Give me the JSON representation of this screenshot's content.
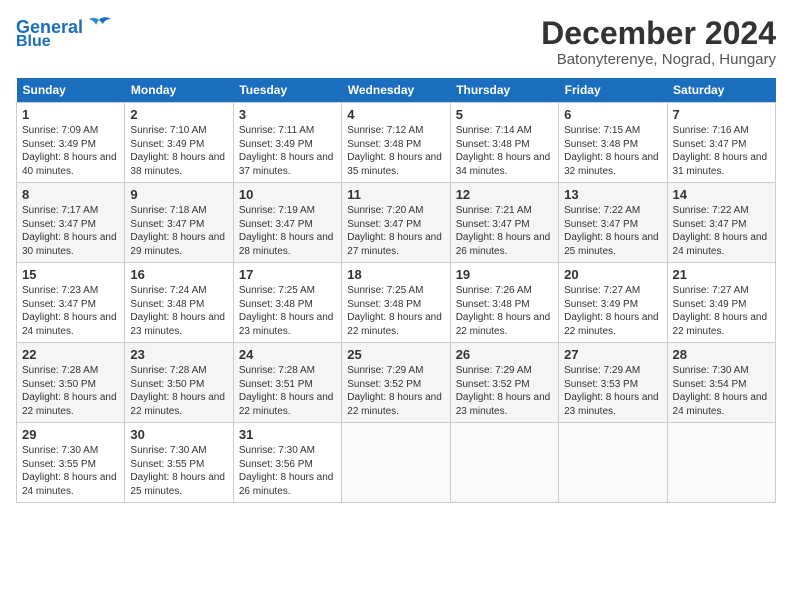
{
  "header": {
    "logo_line1": "General",
    "logo_line2": "Blue",
    "month_title": "December 2024",
    "location": "Batonyterenye, Nograd, Hungary"
  },
  "weekdays": [
    "Sunday",
    "Monday",
    "Tuesday",
    "Wednesday",
    "Thursday",
    "Friday",
    "Saturday"
  ],
  "weeks": [
    [
      {
        "day": "1",
        "rise": "7:09 AM",
        "set": "3:49 PM",
        "hours": "8 hours and 40 minutes."
      },
      {
        "day": "2",
        "rise": "7:10 AM",
        "set": "3:49 PM",
        "hours": "8 hours and 38 minutes."
      },
      {
        "day": "3",
        "rise": "7:11 AM",
        "set": "3:49 PM",
        "hours": "8 hours and 37 minutes."
      },
      {
        "day": "4",
        "rise": "7:12 AM",
        "set": "3:48 PM",
        "hours": "8 hours and 35 minutes."
      },
      {
        "day": "5",
        "rise": "7:14 AM",
        "set": "3:48 PM",
        "hours": "8 hours and 34 minutes."
      },
      {
        "day": "6",
        "rise": "7:15 AM",
        "set": "3:48 PM",
        "hours": "8 hours and 32 minutes."
      },
      {
        "day": "7",
        "rise": "7:16 AM",
        "set": "3:47 PM",
        "hours": "8 hours and 31 minutes."
      }
    ],
    [
      {
        "day": "8",
        "rise": "7:17 AM",
        "set": "3:47 PM",
        "hours": "8 hours and 30 minutes."
      },
      {
        "day": "9",
        "rise": "7:18 AM",
        "set": "3:47 PM",
        "hours": "8 hours and 29 minutes."
      },
      {
        "day": "10",
        "rise": "7:19 AM",
        "set": "3:47 PM",
        "hours": "8 hours and 28 minutes."
      },
      {
        "day": "11",
        "rise": "7:20 AM",
        "set": "3:47 PM",
        "hours": "8 hours and 27 minutes."
      },
      {
        "day": "12",
        "rise": "7:21 AM",
        "set": "3:47 PM",
        "hours": "8 hours and 26 minutes."
      },
      {
        "day": "13",
        "rise": "7:22 AM",
        "set": "3:47 PM",
        "hours": "8 hours and 25 minutes."
      },
      {
        "day": "14",
        "rise": "7:22 AM",
        "set": "3:47 PM",
        "hours": "8 hours and 24 minutes."
      }
    ],
    [
      {
        "day": "15",
        "rise": "7:23 AM",
        "set": "3:47 PM",
        "hours": "8 hours and 24 minutes."
      },
      {
        "day": "16",
        "rise": "7:24 AM",
        "set": "3:48 PM",
        "hours": "8 hours and 23 minutes."
      },
      {
        "day": "17",
        "rise": "7:25 AM",
        "set": "3:48 PM",
        "hours": "8 hours and 23 minutes."
      },
      {
        "day": "18",
        "rise": "7:25 AM",
        "set": "3:48 PM",
        "hours": "8 hours and 22 minutes."
      },
      {
        "day": "19",
        "rise": "7:26 AM",
        "set": "3:48 PM",
        "hours": "8 hours and 22 minutes."
      },
      {
        "day": "20",
        "rise": "7:27 AM",
        "set": "3:49 PM",
        "hours": "8 hours and 22 minutes."
      },
      {
        "day": "21",
        "rise": "7:27 AM",
        "set": "3:49 PM",
        "hours": "8 hours and 22 minutes."
      }
    ],
    [
      {
        "day": "22",
        "rise": "7:28 AM",
        "set": "3:50 PM",
        "hours": "8 hours and 22 minutes."
      },
      {
        "day": "23",
        "rise": "7:28 AM",
        "set": "3:50 PM",
        "hours": "8 hours and 22 minutes."
      },
      {
        "day": "24",
        "rise": "7:28 AM",
        "set": "3:51 PM",
        "hours": "8 hours and 22 minutes."
      },
      {
        "day": "25",
        "rise": "7:29 AM",
        "set": "3:52 PM",
        "hours": "8 hours and 22 minutes."
      },
      {
        "day": "26",
        "rise": "7:29 AM",
        "set": "3:52 PM",
        "hours": "8 hours and 23 minutes."
      },
      {
        "day": "27",
        "rise": "7:29 AM",
        "set": "3:53 PM",
        "hours": "8 hours and 23 minutes."
      },
      {
        "day": "28",
        "rise": "7:30 AM",
        "set": "3:54 PM",
        "hours": "8 hours and 24 minutes."
      }
    ],
    [
      {
        "day": "29",
        "rise": "7:30 AM",
        "set": "3:55 PM",
        "hours": "8 hours and 24 minutes."
      },
      {
        "day": "30",
        "rise": "7:30 AM",
        "set": "3:55 PM",
        "hours": "8 hours and 25 minutes."
      },
      {
        "day": "31",
        "rise": "7:30 AM",
        "set": "3:56 PM",
        "hours": "8 hours and 26 minutes."
      },
      null,
      null,
      null,
      null
    ]
  ]
}
